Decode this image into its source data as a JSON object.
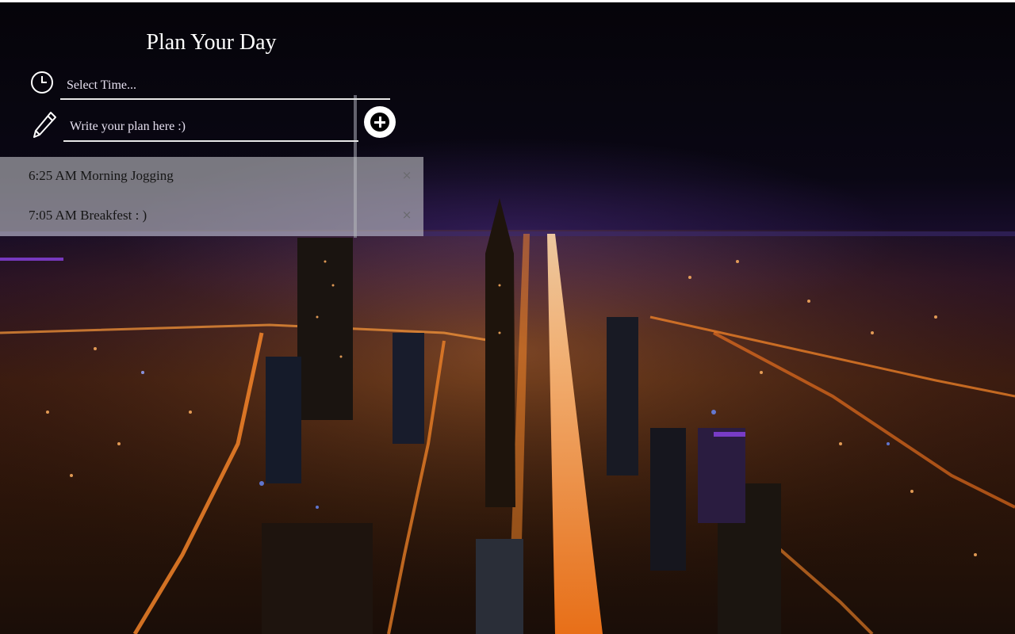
{
  "planner": {
    "title": "Plan Your Day",
    "time_input": {
      "placeholder": "Select Time...",
      "value": ""
    },
    "plan_input": {
      "placeholder": "Write your plan here :)",
      "value": ""
    },
    "add_button_icon": "plus-circle-icon",
    "plans": [
      {
        "text": "6:25 AM Morning Jogging",
        "close": "×"
      },
      {
        "text": "7:05 AM Breakfest : )",
        "close": "×"
      }
    ]
  },
  "icons": {
    "time": "clock-icon",
    "plan": "pencil-icon",
    "add": "plus-circle-icon",
    "remove": "close-icon"
  },
  "background": {
    "description_icon": "city-night-photo",
    "colors": {
      "sky": "#05040d",
      "lights": "#ff8a2a",
      "glow": "#6a3cff"
    }
  }
}
